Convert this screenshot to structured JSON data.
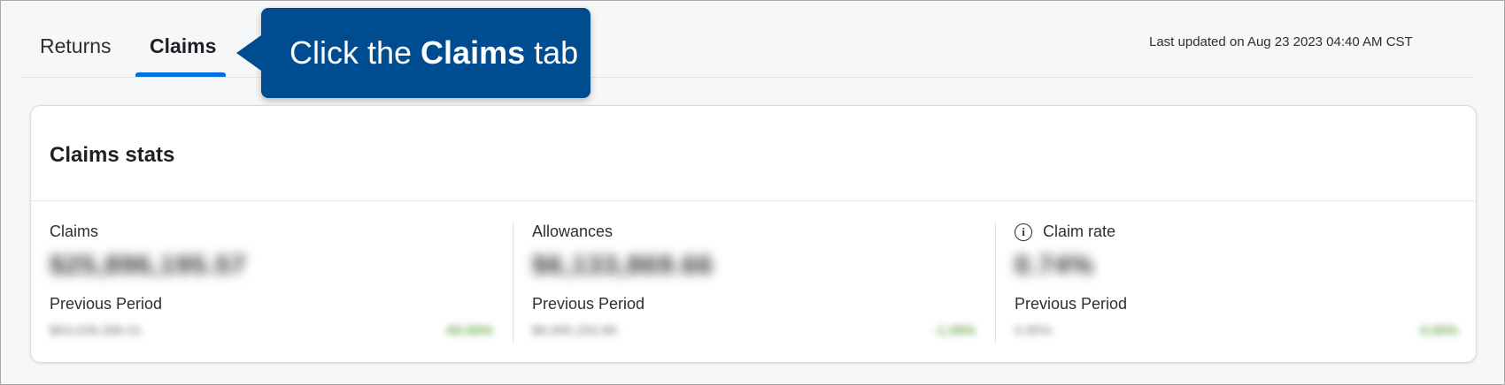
{
  "tabs": [
    {
      "label": "Returns"
    },
    {
      "label": "Claims"
    }
  ],
  "last_updated": "Last updated on Aug 23 2023 04:40 AM CST",
  "callout": {
    "before": "Click the",
    "emphasis": "Claims",
    "after": "tab"
  },
  "card": {
    "title": "Claims stats"
  },
  "stats": [
    {
      "label": "Claims",
      "value": "$25,896,195.57",
      "previous_label": "Previous Period",
      "previous_value": "$63,039,286.01",
      "delta": "-60.60%"
    },
    {
      "label": "Allowances",
      "value": "$6,133,869.66",
      "previous_label": "Previous Period",
      "previous_value": "$6,995,293.80",
      "delta": "-1.09%"
    },
    {
      "label": "Claim rate",
      "value": "0.74%",
      "previous_label": "Previous Period",
      "previous_value": "0.95%",
      "delta": "0.00%",
      "icon": "info-icon"
    }
  ],
  "colors": {
    "accent": "#0071dc",
    "callout": "#004c91",
    "positive": "#2a8703"
  }
}
